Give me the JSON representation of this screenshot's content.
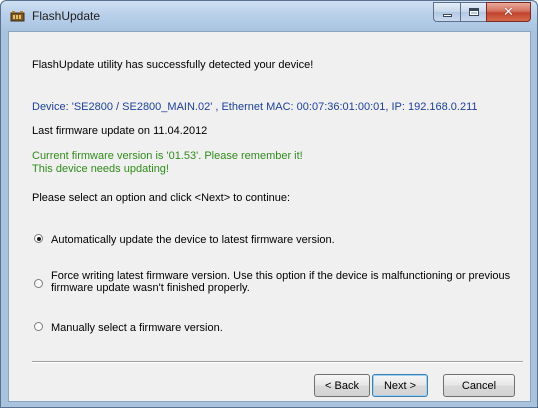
{
  "window": {
    "title": "FlashUpdate",
    "close_glyph": "✕"
  },
  "content": {
    "success_msg": "FlashUpdate utility has successfully detected your device!",
    "device_info": "Device: 'SE2800 / SE2800_MAIN.02' , Ethernet MAC: 00:07:36:01:00:01, IP: 192.168.0.211",
    "last_update": "Last firmware update on 11.04.2012",
    "current_version": "Current firmware version is '01.53'. Please remember it!",
    "needs_update": "This device needs updating!",
    "instruction": "Please select an option and click <Next> to continue:"
  },
  "options": [
    {
      "label": "Automatically update the device to latest firmware version.",
      "selected": true
    },
    {
      "label_line1": "Force writing latest firmware version. Use this option if the device is malfunctioning or previous",
      "label_line2": "firmware update wasn't finished properly.",
      "selected": false
    },
    {
      "label": "Manually select a firmware version.",
      "selected": false
    }
  ],
  "buttons": {
    "back": "< Back",
    "next": "Next >",
    "cancel": "Cancel"
  },
  "colors": {
    "info_blue": "#1c3f9e",
    "status_green": "#2f8c1a"
  },
  "icons": {
    "app": "flashupdate-app-icon",
    "minimize": "minimize-icon",
    "maximize": "maximize-icon",
    "close": "close-icon"
  }
}
